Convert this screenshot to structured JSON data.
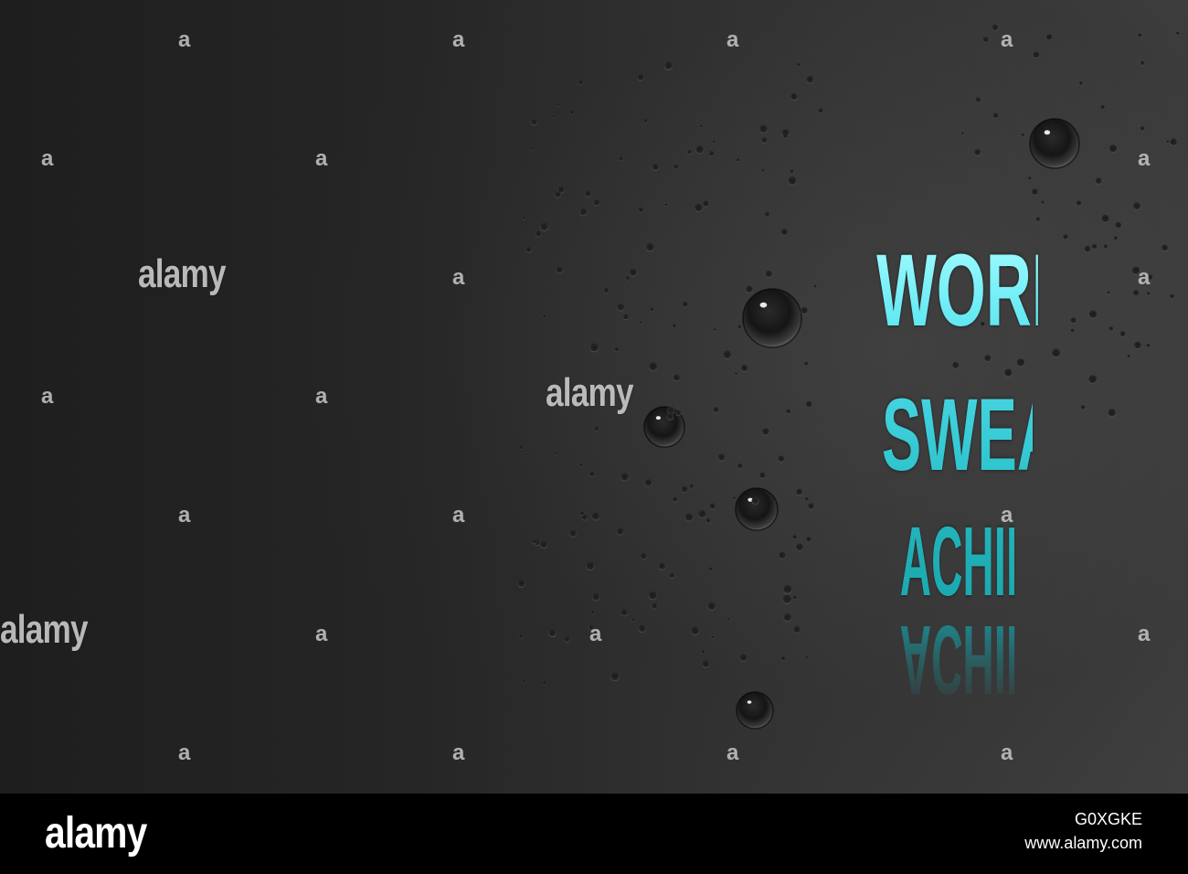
{
  "poster": {
    "lines": [
      "WORK",
      "SWEAT",
      "ACHIEVE"
    ],
    "reflection": "ACHIEVE",
    "accent_color": "#3fd6e3",
    "background_color": "#2e2e2e"
  },
  "watermark": {
    "text": "alamy",
    "mark": "a"
  },
  "footer": {
    "logo": "alamy",
    "image_id": "G0XGKE",
    "site": "www.alamy.com"
  }
}
